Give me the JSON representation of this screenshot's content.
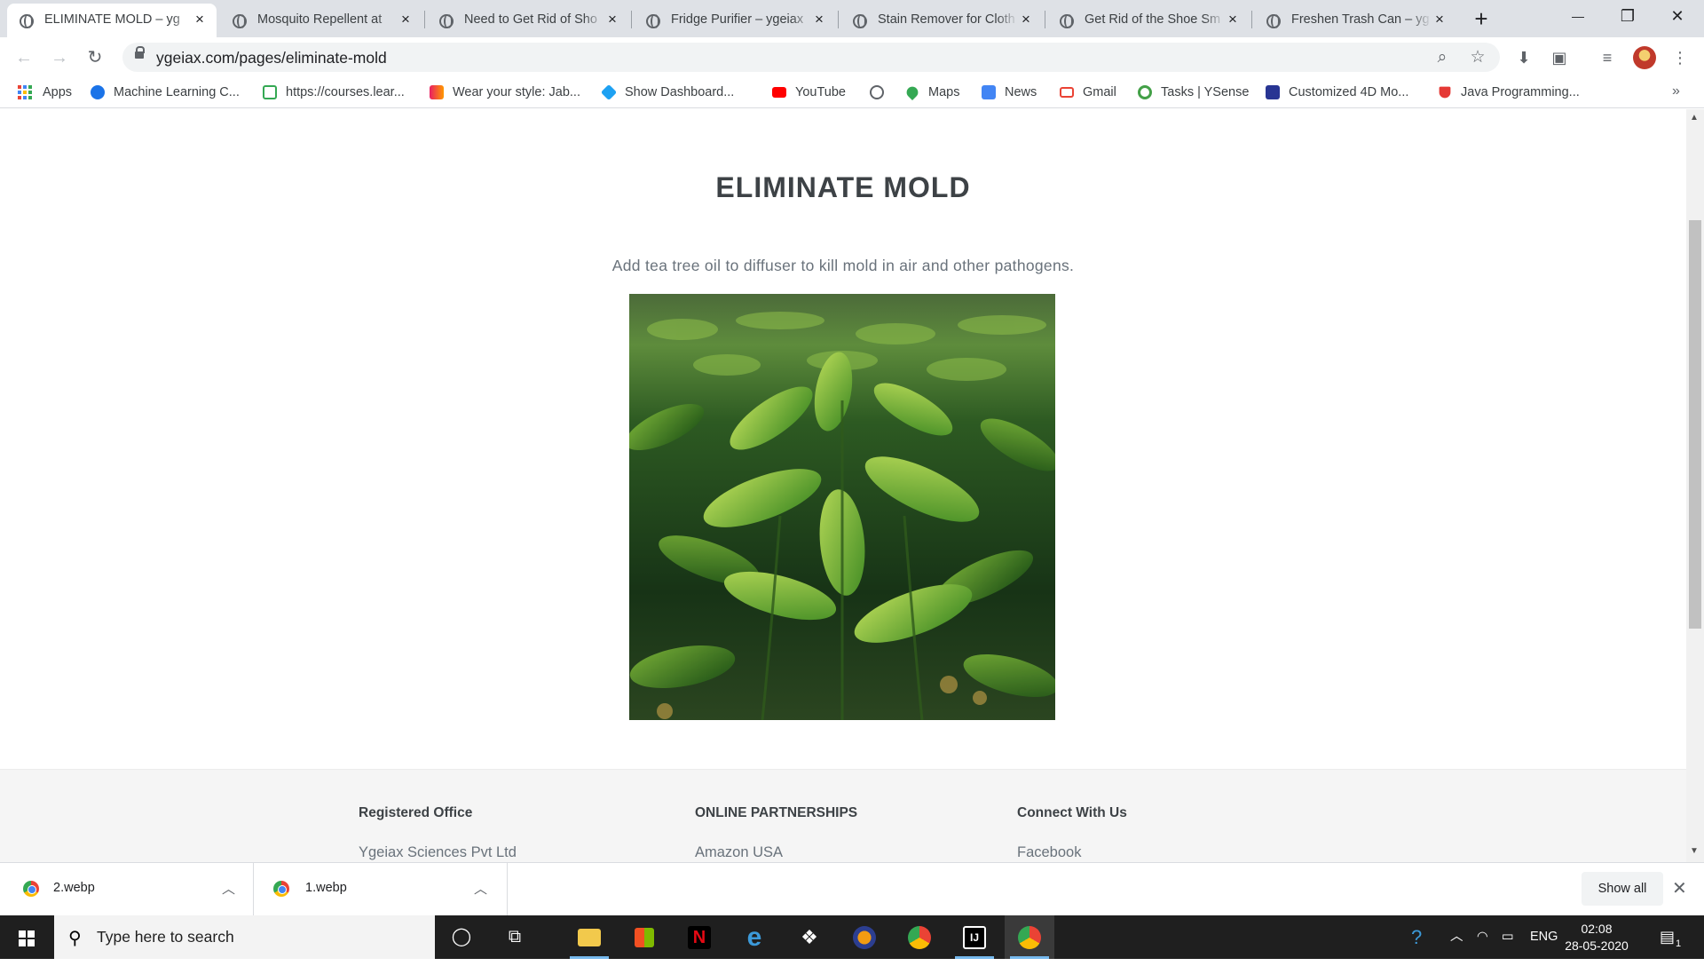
{
  "browser": {
    "tabs": [
      {
        "title": "ELIMINATE MOLD – yg",
        "active": true
      },
      {
        "title": "Mosquito Repellent at",
        "active": false
      },
      {
        "title": "Need to Get Rid of Sho",
        "active": false
      },
      {
        "title": "Fridge Purifier – ygeiax",
        "active": false
      },
      {
        "title": "Stain Remover for Cloth",
        "active": false
      },
      {
        "title": "Get Rid of the Shoe Sm",
        "active": false
      },
      {
        "title": "Freshen Trash Can – yg",
        "active": false
      }
    ],
    "new_tab": "+",
    "window_controls": {
      "minimize": "—",
      "restore": "❐",
      "close": "✕"
    },
    "address": "ygeiax.com/pages/eliminate-mold",
    "bookmarks": [
      {
        "label": "Apps",
        "color": "#4285f4"
      },
      {
        "label": "Machine Learning C...",
        "color": "#1a73e8"
      },
      {
        "label": "https://courses.lear...",
        "color": "#34a853"
      },
      {
        "label": "Wear your style: Jab...",
        "color": "#e91e63"
      },
      {
        "label": "Show Dashboard...",
        "color": "#1da1f2"
      },
      {
        "label": "YouTube",
        "color": "#ff0000"
      },
      {
        "label": "",
        "color": "#5f6368"
      },
      {
        "label": "Maps",
        "color": "#34a853"
      },
      {
        "label": "News",
        "color": "#4285f4"
      },
      {
        "label": "Gmail",
        "color": "#ea4335"
      },
      {
        "label": "Tasks | YSense",
        "color": "#43a047"
      },
      {
        "label": "Customized 4D Mo...",
        "color": "#283593"
      },
      {
        "label": "Java Programming...",
        "color": "#e53935"
      }
    ],
    "bookmarks_more": "»"
  },
  "page": {
    "title": "ELIMINATE MOLD",
    "description": "Add tea tree oil to diffuser to kill mold in air and other pathogens.",
    "image_icon": "tea-leaves-photo",
    "footer": {
      "columns": [
        {
          "heading": "Registered Office",
          "first_item": "Ygeiax Sciences Pvt Ltd"
        },
        {
          "heading": "ONLINE PARTNERSHIPS",
          "first_item": "Amazon USA"
        },
        {
          "heading": "Connect With Us",
          "first_item": "Facebook"
        }
      ]
    }
  },
  "downloads": {
    "items": [
      {
        "name": "2.webp"
      },
      {
        "name": "1.webp"
      }
    ],
    "show_all": "Show all",
    "close": "✕"
  },
  "taskbar": {
    "search_placeholder": "Type here to search",
    "language": "ENG",
    "time": "02:08",
    "date": "28-05-2020",
    "notifications": "1"
  }
}
